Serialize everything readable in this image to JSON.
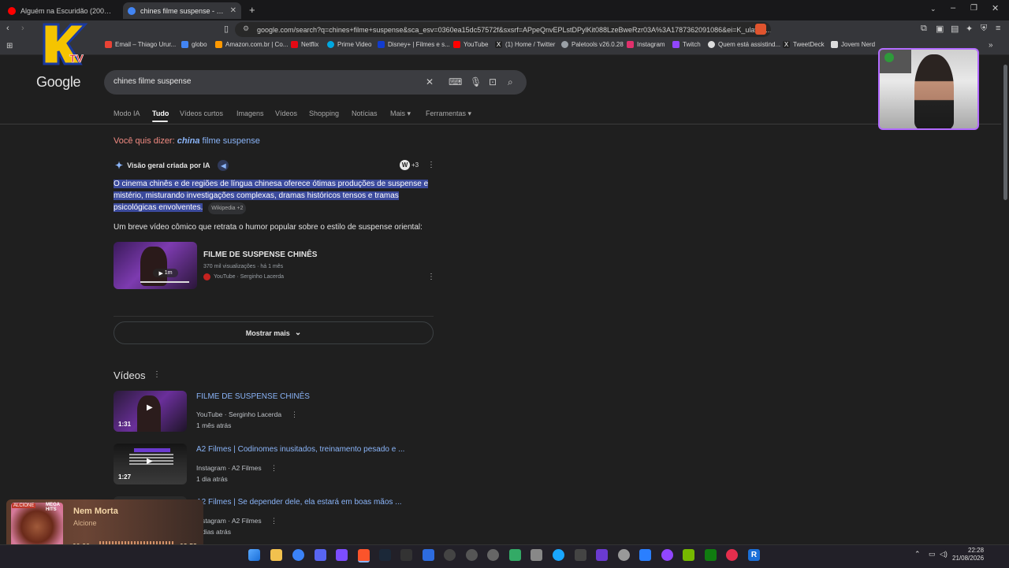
{
  "browser": {
    "tabs": [
      {
        "title": "Alguém na Escuridão (2000) - Chama",
        "active": false,
        "favicon_color": "#ff0000"
      },
      {
        "title": "chines filme suspense - Pesquisa",
        "active": true,
        "favicon_color": "#4285f4"
      }
    ],
    "url": "google.com/search?q=chines+filme+suspense&sca_esv=0360ea15dc57572f&sxsrf=APpeQnvEPLstDPylKit088LzeBweRzr03A%3A1787362091086&ei=K_ulav7s...",
    "bookmarks": [
      {
        "label": "Email – Thiago Urur...",
        "color": "#ea4335"
      },
      {
        "label": "globo",
        "color": "#4285f4"
      },
      {
        "label": "Amazon.com.br | Co...",
        "color": "#ff9900"
      },
      {
        "label": "Netflix",
        "color": "#e50914"
      },
      {
        "label": "Prime Video",
        "color": "#00a8e1"
      },
      {
        "label": "Disney+ | Filmes e s...",
        "color": "#113ccf"
      },
      {
        "label": "YouTube",
        "color": "#ff0000"
      },
      {
        "label": "(1) Home / Twitter",
        "color": "#dddddd"
      },
      {
        "label": "Paletools v26.0.28",
        "color": "#9aa0a6"
      },
      {
        "label": "Instagram",
        "color": "#e1306c"
      },
      {
        "label": "Twitch",
        "color": "#9146ff"
      },
      {
        "label": "Quem está assistind...",
        "color": "#dddddd"
      },
      {
        "label": "TweetDeck",
        "color": "#dddddd"
      },
      {
        "label": "Jovem Nerd",
        "color": "#dddddd"
      }
    ]
  },
  "google": {
    "logo": "Google",
    "query": "chines filme suspense",
    "nav": [
      "Modo IA",
      "Tudo",
      "Vídeos curtos",
      "Imagens",
      "Vídeos",
      "Shopping",
      "Notícias",
      "Mais ▾",
      "Ferramentas ▾"
    ],
    "did_you_mean_label": "Você quis dizer:",
    "did_you_mean_bold": "china",
    "did_you_mean_rest": " filme suspense",
    "ai_overview_label": "Visão geral criada por IA",
    "ai_plus": "+3",
    "ai_summary": "O cinema chinês e de regiões de língua chinesa oferece ótimas produções de suspense e mistério, misturando investigações complexas, dramas históricos tensos e tramas psicológicas envolventes.",
    "ai_source": "Wikipedia +2",
    "ai_sub": "Um breve vídeo cômico que retrata o humor popular sobre o estilo de suspense oriental:",
    "ai_video": {
      "title": "FILME DE SUSPENSE CHINÊS",
      "meta": "370 mil visualizações · há 1 mês",
      "channel": "YouTube · Serginho Lacerda",
      "duration": "1m"
    },
    "show_more": "Mostrar mais",
    "videos_heading": "Vídeos",
    "videos": [
      {
        "title": "FILME DE SUSPENSE CHINÊS",
        "source": "YouTube · Serginho Lacerda",
        "age": "1 mês atrás",
        "duration": "1:31"
      },
      {
        "title": "A2 Filmes | Codinomes inusitados, treinamento pesado e ...",
        "source": "Instagram · A2 Filmes",
        "age": "1 dia atrás",
        "duration": "1:27"
      },
      {
        "title": "A2 Filmes | Se depender dele, ela estará em boas mãos ...",
        "source": "Instagram · A2 Filmes",
        "age": "2 dias atrás",
        "duration": ""
      }
    ]
  },
  "music": {
    "badge": "ALCIONE",
    "badge2": "MEGA HITS",
    "title": "Nem Morta",
    "artist": "Alcione",
    "current": "00:26",
    "length": "03:53",
    "progress_fraction": 0.11
  },
  "taskbar": {
    "time": "22:28",
    "date": "21/08/2026"
  },
  "colors": {
    "accent_link": "#8ab4f8",
    "did_you_mean": "#f28b82",
    "webcam_border": "#b36bff"
  }
}
